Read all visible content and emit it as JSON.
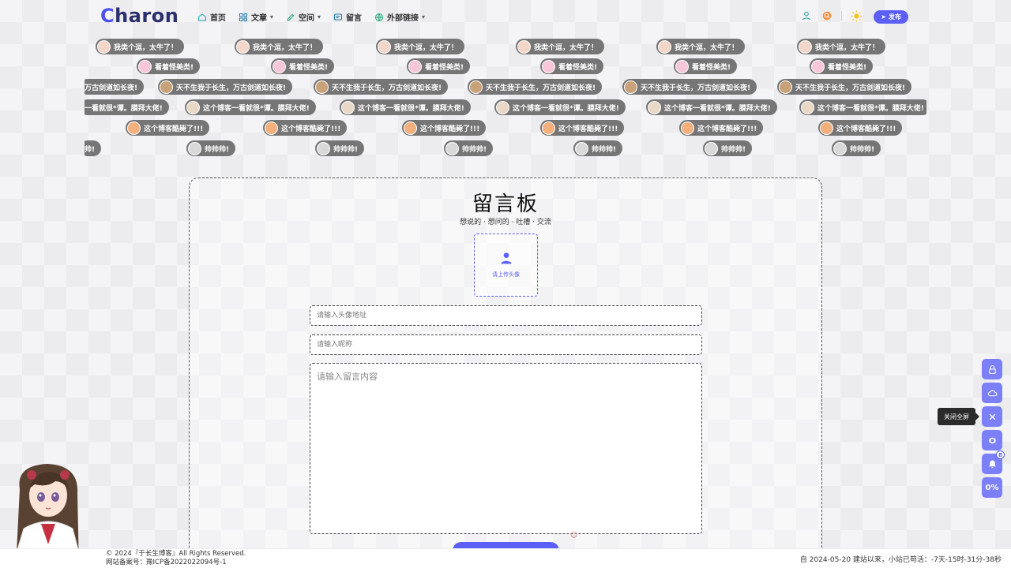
{
  "header": {
    "logo_initial": "C",
    "logo_rest": "haron",
    "nav": [
      {
        "label": "首页",
        "icon": "home-icon",
        "dropdown": false
      },
      {
        "label": "文章",
        "icon": "grid-icon",
        "dropdown": true
      },
      {
        "label": "空间",
        "icon": "pen-icon",
        "dropdown": true
      },
      {
        "label": "留言",
        "icon": "message-icon",
        "dropdown": false
      },
      {
        "label": "外部链接",
        "icon": "globe-icon",
        "dropdown": true
      }
    ],
    "publish_label": "发布"
  },
  "barrage": {
    "rows": [
      {
        "text": "我类个逗，太牛了！",
        "color": "#f2d7c9"
      },
      {
        "text": "看着怪美类!",
        "color": "#f7c6d8"
      },
      {
        "text": "天不生我于长生，万古剑道如长夜!",
        "color": "#c9a27a"
      },
      {
        "text": "这个博客一看就很*谭。膜拜大佬!",
        "color": "#e9d8c6"
      },
      {
        "text": "这个博客酷毙了!!!",
        "color": "#f4b07c"
      },
      {
        "text": "帅帅帅!",
        "color": "#d9d9d9"
      }
    ],
    "cut_left": [
      "万古剑道如长夜!",
      "一看就很*谭。膜拜大佬!",
      "帅!"
    ]
  },
  "guestbook": {
    "title": "留言板",
    "subtitle": "想说的 · 想问的 · 吐槽 · 交流",
    "upload_label": "请上传头像",
    "avatar_url_placeholder": "请输入头像地址",
    "nickname_placeholder": "请输入昵称",
    "content_placeholder": "请输入留言内容"
  },
  "tools": {
    "items": [
      {
        "name": "lock-icon"
      },
      {
        "name": "cloud-icon"
      },
      {
        "name": "close-fullscreen-icon"
      },
      {
        "name": "settings-icon"
      },
      {
        "name": "bell-icon",
        "badge": "8"
      },
      {
        "name": "scroll-progress",
        "label": "0%"
      }
    ],
    "tooltip": "关闭全屏"
  },
  "footer": {
    "copyright": "© 2024『于长生博客』All Rights Reserved.",
    "icp": "网站备案号：豫ICP备2022022094号-1",
    "uptime": "自 2024-05-20 建站以来，小站已苟活：-7天-15时-31分-38秒"
  },
  "colors": {
    "accent": "#5b5ff5",
    "tool_bg": "#7b7ff8",
    "logo": "#2a2f6d"
  }
}
